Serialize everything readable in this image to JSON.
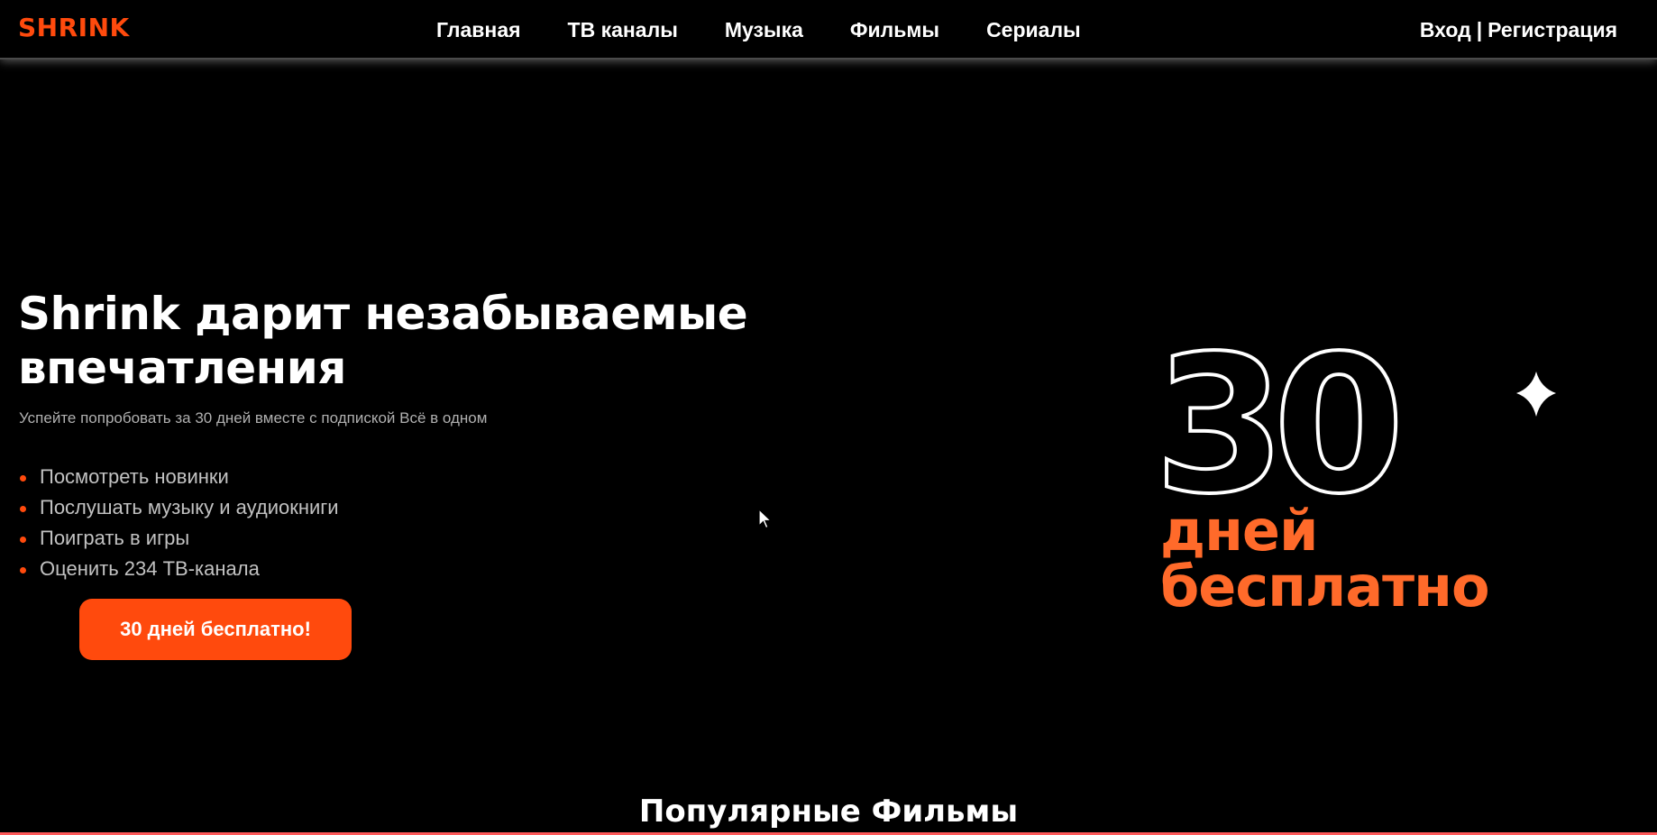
{
  "header": {
    "logo": "SHRINK",
    "nav": [
      "Главная",
      "ТВ каналы",
      "Музыка",
      "Фильмы",
      "Сериалы"
    ],
    "login_label": "Вход",
    "separator": "|",
    "register_label": "Регистрация"
  },
  "hero": {
    "title_line1": "Shrink дарит незабываемые",
    "title_line2": "впечатления",
    "subtitle": "Успейте попробовать за 30 дней вместе с подпиской Всё в одном",
    "features": [
      "Посмотреть новинки",
      "Послушать музыку и аудиокниги",
      "Поиграть в игры",
      "Оценить 234 ТВ-канала"
    ],
    "cta_label": "30 дней бесплатно!"
  },
  "promo": {
    "number": "30",
    "line1": "дней",
    "line2": "бесплатно"
  },
  "section": {
    "title": "Популярные Фильмы"
  },
  "colors": {
    "accent": "#ff4a0d",
    "promo_text": "#ff6a2a",
    "background": "#000000",
    "muted_text": "#c2c2c2"
  },
  "icons": {
    "cursor": "mouse-pointer-icon",
    "sparkle": "sparkle-star-icon",
    "bullet": "bullet-dot-icon"
  }
}
